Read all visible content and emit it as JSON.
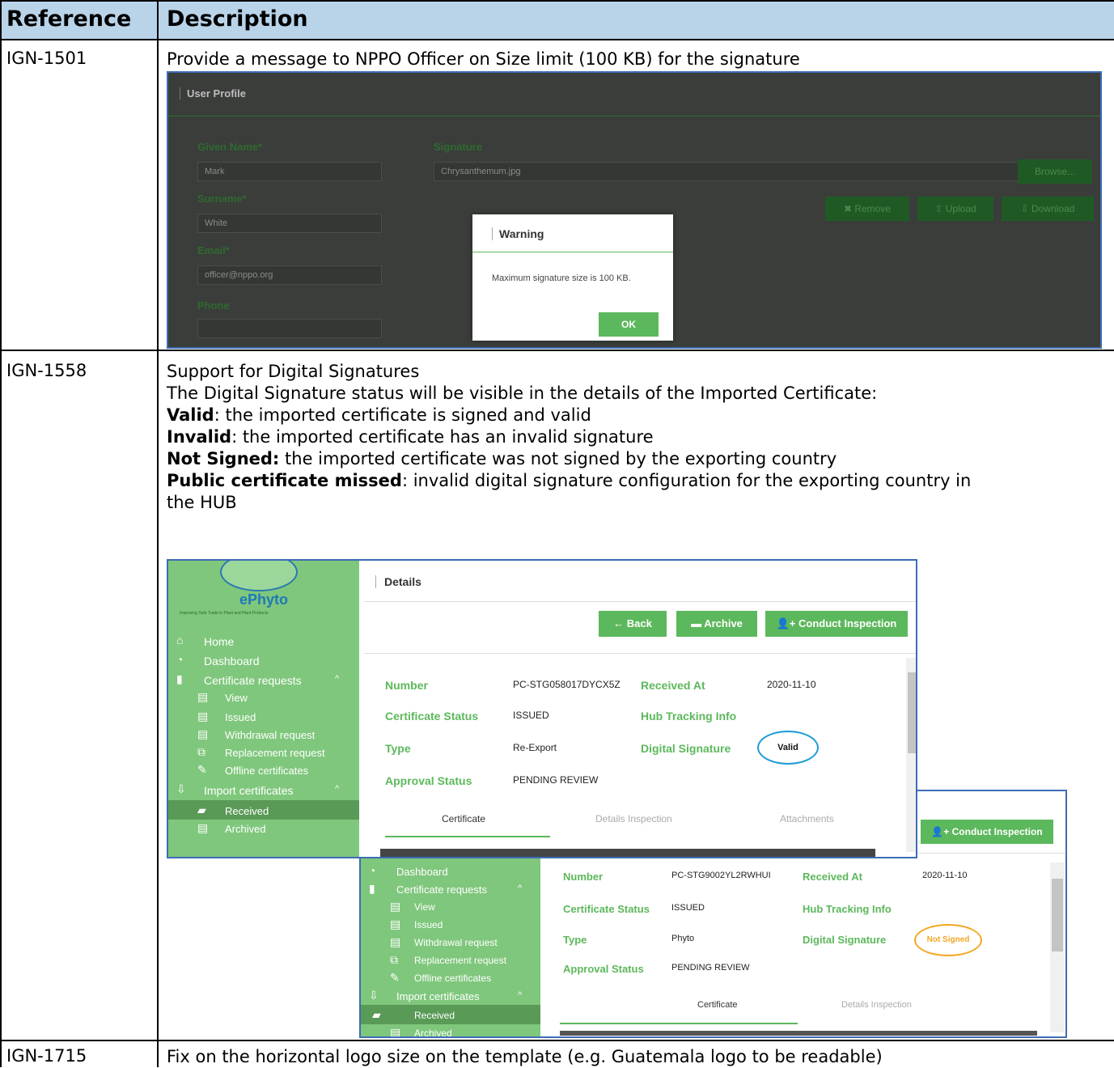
{
  "header": {
    "reference": "Reference",
    "description": "Description"
  },
  "rows": [
    {
      "ref": "IGN-1501",
      "text": "Provide a message to NPPO Officer on Size limit (100 KB) for the signature",
      "screenshot": {
        "title": "User Profile",
        "given_name_label": "Given Name*",
        "given_name": "Mark",
        "surname_label": "Surname*",
        "surname": "White",
        "email_label": "Email*",
        "email": "officer@nppo.org",
        "phone_label": "Phone",
        "signature_label": "Signature",
        "signature_file": "Chrysanthemum.jpg",
        "browse": "Browse...",
        "remove": "✖ Remove",
        "upload": "⇧ Upload",
        "download": "⇩ Download",
        "modal_title": "Warning",
        "modal_message": "Maximum signature size is 100 KB.",
        "modal_ok": "OK"
      }
    },
    {
      "ref": "IGN-1558",
      "line1": "Support for Digital Signatures",
      "line2": "The Digital Signature status will be visible in the details of the Imported Certificate:",
      "valid_b": "Valid",
      "valid_t": ": the imported certificate is signed and valid",
      "invalid_b": "Invalid",
      "invalid_t": ": the imported certificate has an invalid signature",
      "notsigned_b": "Not Signed:",
      "notsigned_t": " the imported certificate was not signed by the exporting country",
      "public_b": "Public certificate missed",
      "public_t": ": invalid digital signature configuration for the exporting country in",
      "public_t2": "the HUB",
      "shotA": {
        "logo": "ePhyto",
        "logo_sub": "Improving Safe Trade in Plant and Plant Products",
        "menu": [
          "Home",
          "Dashboard",
          "Certificate requests",
          "View",
          "Issued",
          "Withdrawal request",
          "Replacement request",
          "Offline certificates",
          "Import certificates",
          "Received",
          "Archived"
        ],
        "title": "Details",
        "back": "← Back",
        "archive": "Archive",
        "conduct": "Conduct Inspection",
        "number_label": "Number",
        "number": "PC-STG058017DYCX5Z",
        "received_label": "Received At",
        "received": "2020-11-10",
        "status_label": "Certificate Status",
        "status": "ISSUED",
        "hub_label": "Hub Tracking Info",
        "type_label": "Type",
        "type": "Re-Export",
        "sig_label": "Digital Signature",
        "sig": "Valid",
        "approval_label": "Approval Status",
        "approval": "PENDING REVIEW",
        "tabs": [
          "Certificate",
          "Details Inspection",
          "Attachments"
        ]
      },
      "shotB": {
        "menu": [
          "Dashboard",
          "Certificate requests",
          "View",
          "Issued",
          "Withdrawal request",
          "Replacement request",
          "Offline certificates",
          "Import certificates",
          "Received",
          "Archived"
        ],
        "conduct": "Conduct Inspection",
        "number_label": "Number",
        "number": "PC-STG9002YL2RWHUI",
        "received_label": "Received At",
        "received": "2020-11-10",
        "status_label": "Certificate Status",
        "status": "ISSUED",
        "hub_label": "Hub Tracking Info",
        "type_label": "Type",
        "type": "Phyto",
        "sig_label": "Digital Signature",
        "sig": "Not Signed",
        "approval_label": "Approval Status",
        "approval": "PENDING REVIEW",
        "tabs": [
          "Certificate",
          "Details Inspection"
        ]
      }
    },
    {
      "ref": "IGN-1715",
      "text": "Fix on the horizontal logo size on the template (e.g. Guatemala logo to be readable)"
    }
  ],
  "colors": {
    "header_bg": "#b9d3e9",
    "green": "#5cb85c",
    "sidebar": "#7fc77c",
    "valid_oval": "#1d9bd6",
    "notsigned_oval": "#f5a623"
  }
}
